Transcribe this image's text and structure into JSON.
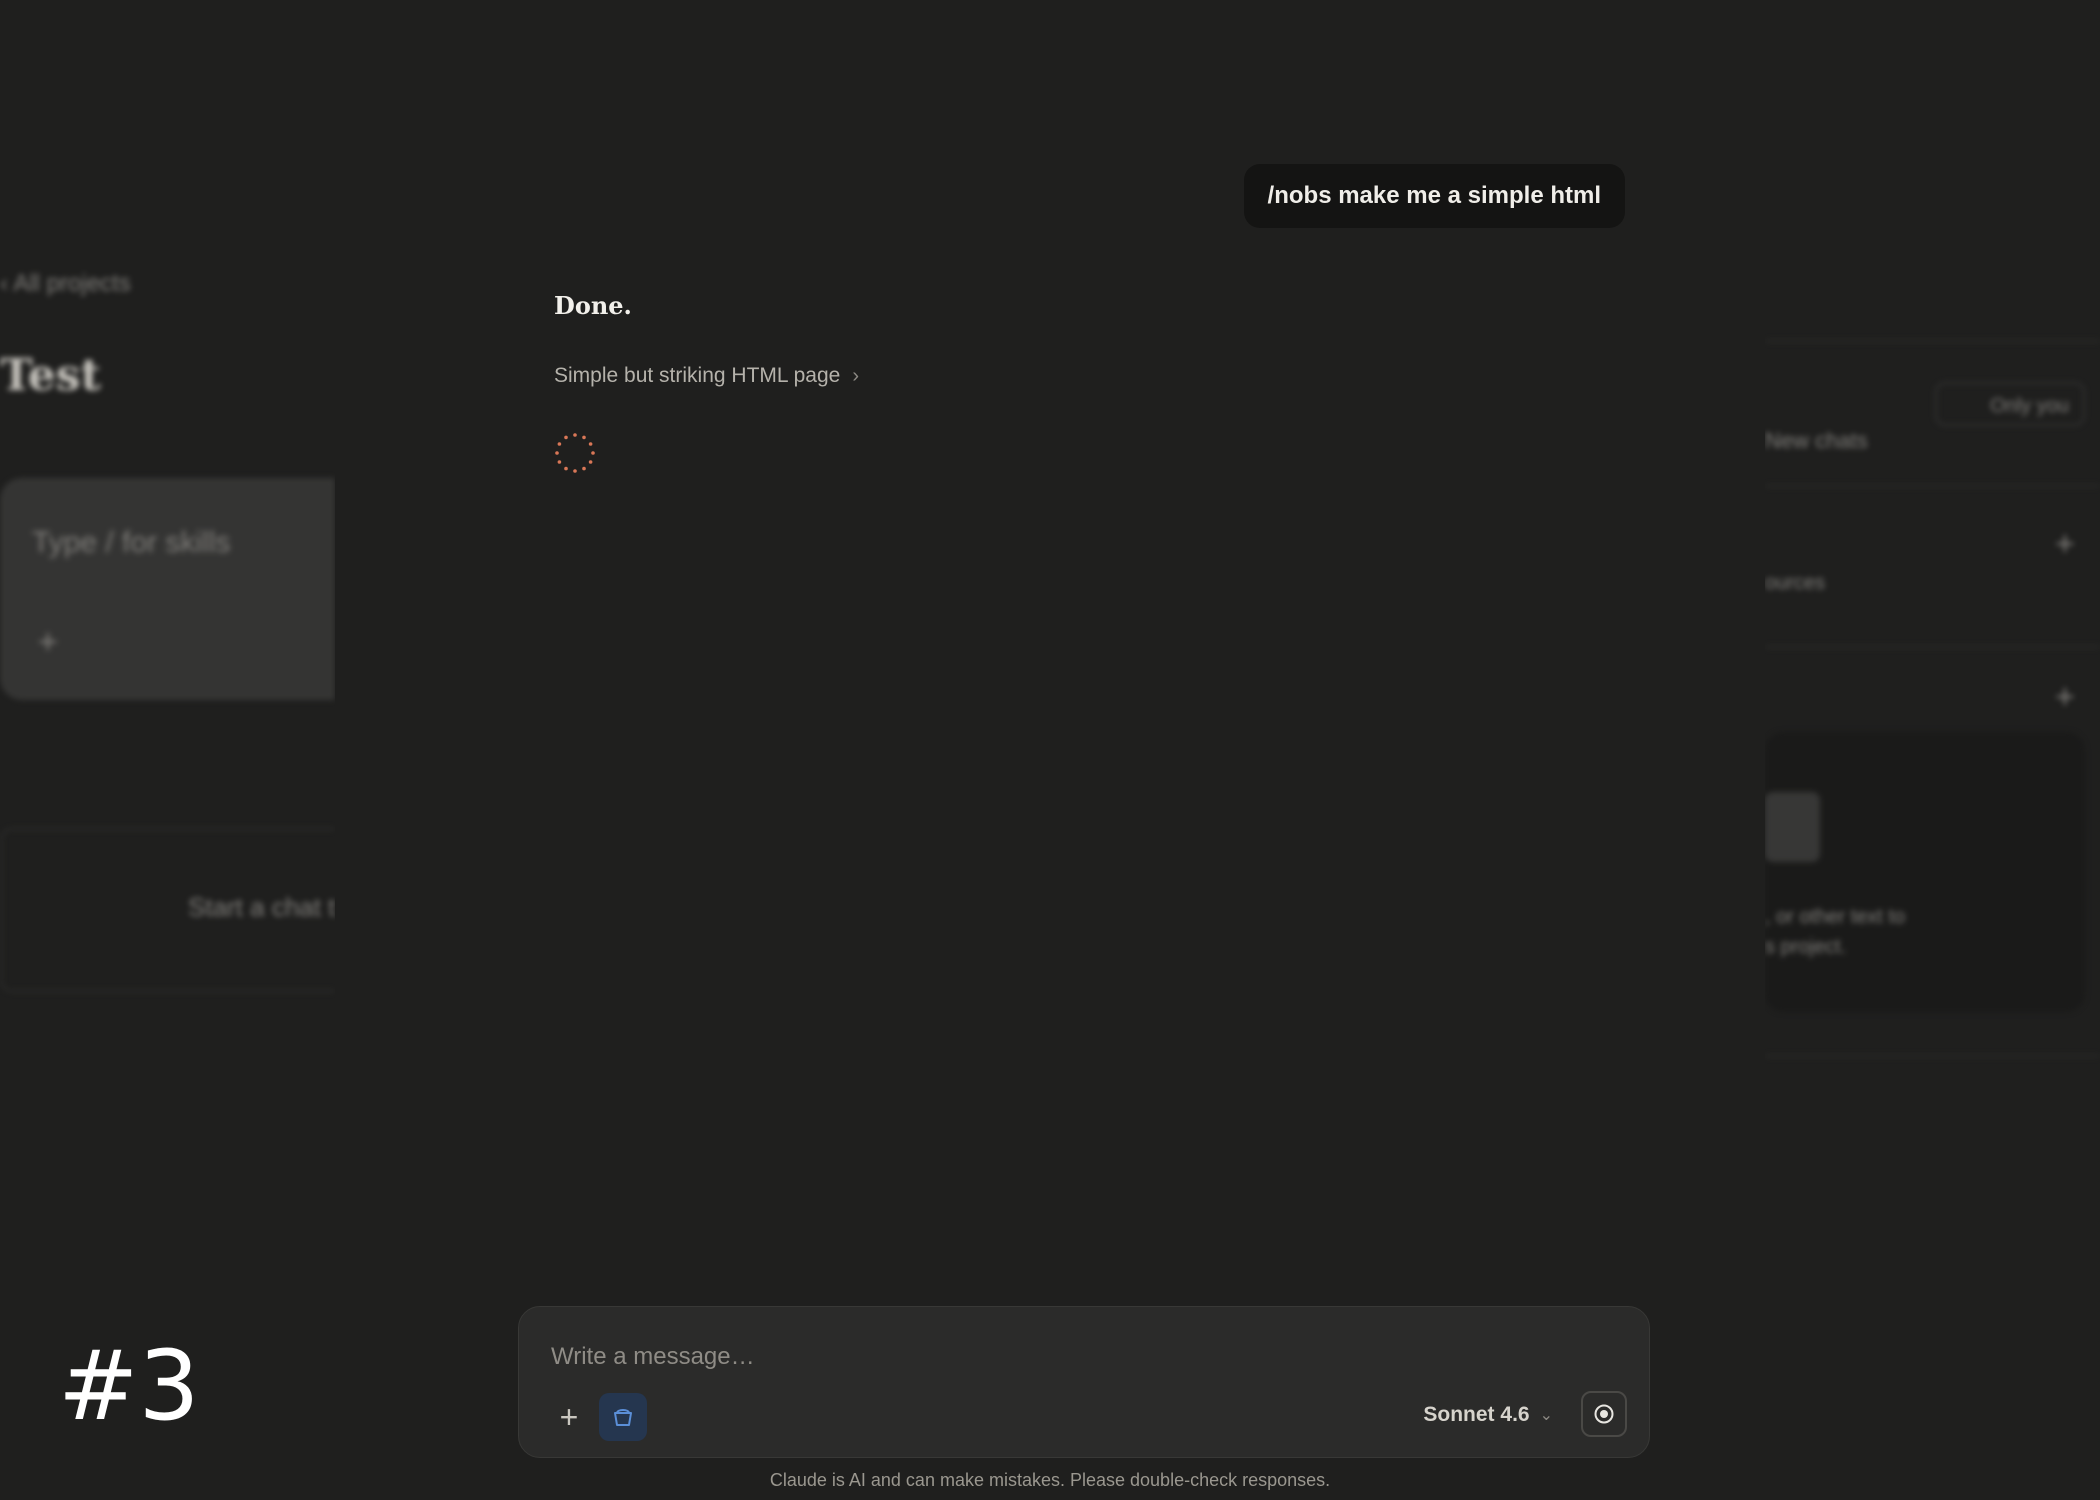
{
  "background": {
    "left": {
      "back_link": "All projects",
      "project_title": "Test",
      "input_placeholder": "Type / for skills",
      "empty_state": "Start a chat t"
    },
    "right": {
      "visibility": "Only you",
      "new_chats": "New chats",
      "instructions_hint": "ources",
      "files_hint_line1": ", or other text to",
      "files_hint_line2": "s project."
    }
  },
  "conversation": {
    "user_message": "/nobs make me a simple html",
    "assistant_reply": "Done.",
    "artifact_title": "Simple but striking HTML page"
  },
  "composer": {
    "placeholder": "Write a message…",
    "model": "Sonnet 4.6"
  },
  "disclaimer": "Claude is AI and can make mistakes. Please double-check responses.",
  "overlay_label": "#3",
  "colors": {
    "background": "#1f1f1e",
    "spinner": "#d97757",
    "tool_active": "#25364f"
  },
  "icons": [
    "plus-icon",
    "spinner-icon",
    "chevron-right-icon",
    "chevron-down-icon",
    "tool-icon",
    "voice-icon"
  ]
}
